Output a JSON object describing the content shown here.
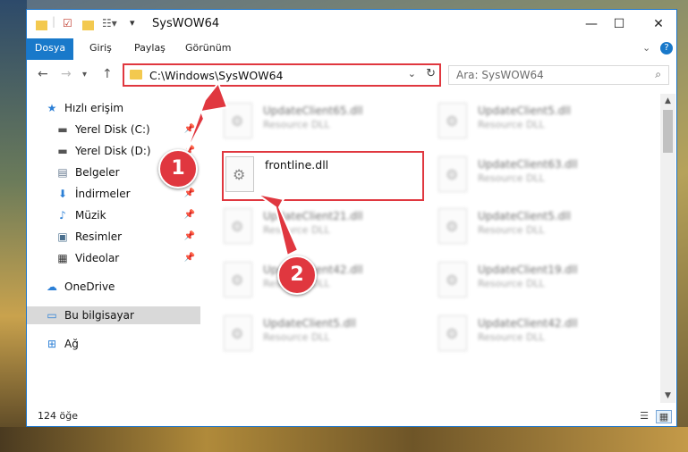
{
  "window": {
    "title": "SysWOW64",
    "help_label": "?"
  },
  "ribbon": {
    "tabs": [
      "Dosya",
      "Giriş",
      "Paylaş",
      "Görünüm"
    ]
  },
  "address": {
    "path": "C:\\Windows\\SysWOW64"
  },
  "search": {
    "placeholder": "Ara: SysWOW64"
  },
  "sidebar": {
    "items": [
      {
        "label": "Hızlı erişim",
        "icon": "star-icon"
      },
      {
        "label": "Yerel Disk (C:)",
        "icon": "drive-icon"
      },
      {
        "label": "Yerel Disk (D:)",
        "icon": "drive-icon"
      },
      {
        "label": "Belgeler",
        "icon": "documents-icon"
      },
      {
        "label": "İndirmeler",
        "icon": "download-icon"
      },
      {
        "label": "Müzik",
        "icon": "music-icon"
      },
      {
        "label": "Resimler",
        "icon": "pictures-icon"
      },
      {
        "label": "Videolar",
        "icon": "videos-icon"
      },
      {
        "label": "OneDrive",
        "icon": "cloud-icon"
      },
      {
        "label": "Bu bilgisayar",
        "icon": "computer-icon"
      },
      {
        "label": "Ağ",
        "icon": "network-icon"
      }
    ]
  },
  "files": {
    "highlighted": {
      "name": "frontline.dll"
    },
    "blurred": [
      {
        "name": "UpdateClient65.dll",
        "type": "Resource DLL"
      },
      {
        "name": "UpdateClient5.dll",
        "type": "Resource DLL"
      },
      {
        "name": "UpdateClient63.dll",
        "type": "Resource DLL"
      },
      {
        "name": "UpdateClient21.dll",
        "type": "Resource DLL"
      },
      {
        "name": "UpdateClient5.dll",
        "type": "Resource DLL"
      },
      {
        "name": "UpdateClient42.dll",
        "type": "Resource DLL"
      },
      {
        "name": "UpdateClient19.dll",
        "type": "Resource DLL"
      },
      {
        "name": "UpdateClient5.dll",
        "type": "Resource DLL"
      },
      {
        "name": "UpdateClient42.dll",
        "type": "Resource DLL"
      }
    ]
  },
  "status": {
    "count": "124 öğe"
  },
  "annotations": {
    "step1": "1",
    "step2": "2",
    "color": "#e0373f"
  },
  "colors": {
    "accent": "#1979ca",
    "highlight": "#e0373f"
  }
}
